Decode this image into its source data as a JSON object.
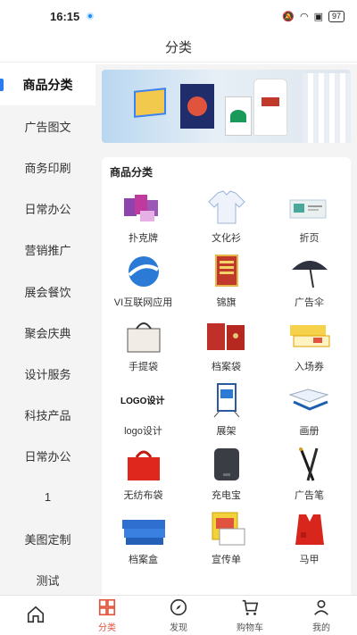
{
  "status": {
    "time": "16:15",
    "battery": "97"
  },
  "header": {
    "title": "分类"
  },
  "sidebar": {
    "items": [
      {
        "label": "商品分类",
        "active": true
      },
      {
        "label": "广告图文"
      },
      {
        "label": "商务印刷"
      },
      {
        "label": "日常办公"
      },
      {
        "label": "营销推广"
      },
      {
        "label": "展会餐饮"
      },
      {
        "label": "聚会庆典"
      },
      {
        "label": "设计服务"
      },
      {
        "label": "科技产品"
      },
      {
        "label": "日常办公"
      },
      {
        "label": "1"
      },
      {
        "label": "美图定制"
      },
      {
        "label": "测试"
      }
    ]
  },
  "main": {
    "section_title": "商品分类",
    "products": [
      {
        "label": "扑克牌",
        "icon": "playing-cards-icon"
      },
      {
        "label": "文化衫",
        "icon": "shirt-icon"
      },
      {
        "label": "折页",
        "icon": "brochure-icon"
      },
      {
        "label": "VI互联网应用",
        "icon": "vi-logo-icon"
      },
      {
        "label": "锦旗",
        "icon": "banner-flag-icon"
      },
      {
        "label": "广告伞",
        "icon": "umbrella-icon"
      },
      {
        "label": "手提袋",
        "icon": "tote-bag-icon"
      },
      {
        "label": "档案袋",
        "icon": "file-bag-icon"
      },
      {
        "label": "入场券",
        "icon": "ticket-icon"
      },
      {
        "label": "logo设计",
        "icon": "logo-design-icon"
      },
      {
        "label": "展架",
        "icon": "display-stand-icon"
      },
      {
        "label": "画册",
        "icon": "album-icon"
      },
      {
        "label": "无纺布袋",
        "icon": "nonwoven-bag-icon"
      },
      {
        "label": "充电宝",
        "icon": "power-bank-icon"
      },
      {
        "label": "广告笔",
        "icon": "pen-icon"
      },
      {
        "label": "档案盒",
        "icon": "file-box-icon"
      },
      {
        "label": "宣传单",
        "icon": "flyer-icon"
      },
      {
        "label": "马甲",
        "icon": "vest-icon"
      }
    ]
  },
  "tabbar": {
    "items": [
      {
        "label": "",
        "icon": "home-icon"
      },
      {
        "label": "分类",
        "icon": "category-icon",
        "active": true
      },
      {
        "label": "发现",
        "icon": "discover-icon"
      },
      {
        "label": "购物车",
        "icon": "cart-icon"
      },
      {
        "label": "我的",
        "icon": "user-icon"
      }
    ]
  },
  "colors": {
    "accent": "#2a7bf0",
    "active_tab": "#e0533c"
  }
}
